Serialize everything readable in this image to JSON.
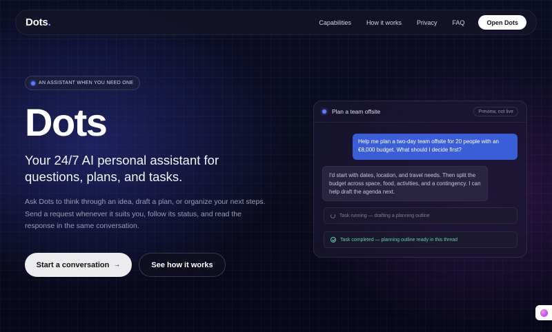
{
  "nav": {
    "brand": "Dots",
    "brand_dot": ".",
    "links": [
      "Capabilities",
      "How it works",
      "Privacy",
      "FAQ"
    ],
    "cta": "Open Dots"
  },
  "hero": {
    "badge": "AN ASSISTANT WHEN YOU NEED ONE",
    "title": "Dots",
    "subtitle": "Your 24/7 AI personal assistant for questions, plans, and tasks.",
    "description": "Ask Dots to think through an idea, draft a plan, or organize your next steps. Send a request whenever it suits you, follow its status, and read the response in the same conversation.",
    "primary_button": "Start a conversation",
    "primary_arrow": "→",
    "secondary_button": "See how it works"
  },
  "chat": {
    "title": "Plan a team offsite",
    "preview_label": "Preview, not live",
    "user_message": "Help me plan a two-day team offsite for 20 people with an €8,000 budget. What should I decide first?",
    "assistant_message": "I'd start with dates, location, and travel needs. Then split the budget across space, food, activities, and a contingency. I can help draft the agenda next.",
    "status_running": "Task running — drafting a planning outline",
    "status_done": "Task completed — planning outline ready in this thread"
  },
  "colors": {
    "accent": "#5b7cff",
    "user_bubble": "#3a5dd8",
    "success": "#5fd3a6"
  },
  "icons": {
    "status_running": "spinner-icon",
    "status_done": "check-circle-icon",
    "widget": "assistant-orb-icon"
  }
}
